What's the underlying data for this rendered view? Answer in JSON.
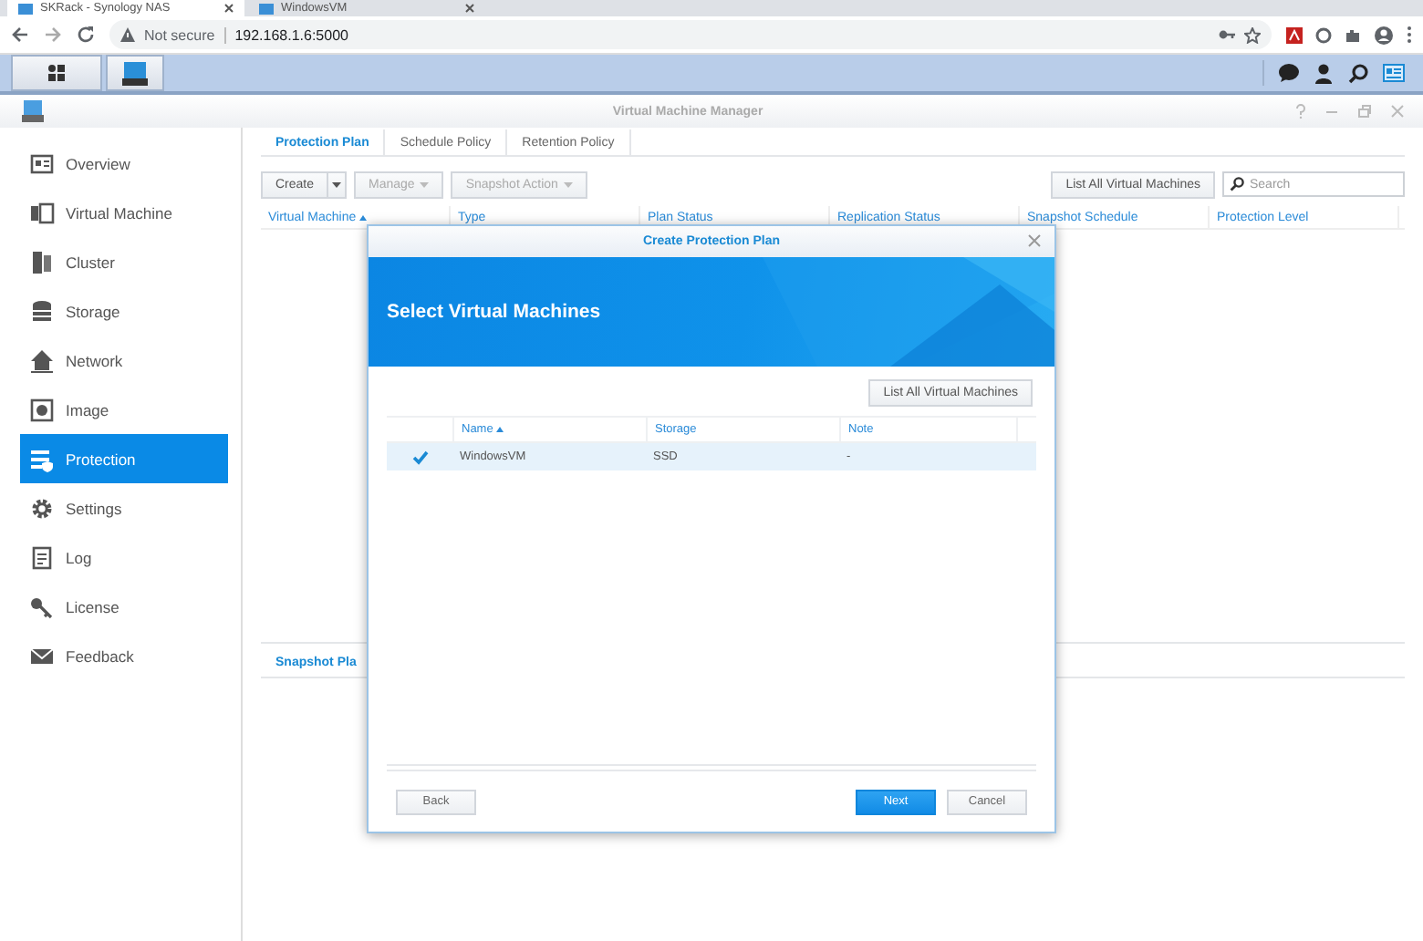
{
  "browser": {
    "tabs": [
      {
        "title": "SKRack - Synology NAS",
        "selected": true
      },
      {
        "title": "WindowsVM",
        "selected": false
      }
    ],
    "security": "Not secure",
    "url": "192.168.1.6:5000"
  },
  "window": {
    "title": "Virtual Machine Manager"
  },
  "sidebar": {
    "items": [
      {
        "label": "Overview",
        "selected": false
      },
      {
        "label": "Virtual Machine",
        "selected": false
      },
      {
        "label": "Cluster",
        "selected": false
      },
      {
        "label": "Storage",
        "selected": false
      },
      {
        "label": "Network",
        "selected": false
      },
      {
        "label": "Image",
        "selected": false
      },
      {
        "label": "Protection",
        "selected": true
      },
      {
        "label": "Settings",
        "selected": false
      },
      {
        "label": "Log",
        "selected": false
      },
      {
        "label": "License",
        "selected": false
      },
      {
        "label": "Feedback",
        "selected": false
      }
    ]
  },
  "tabs": [
    {
      "label": "Protection Plan",
      "selected": true
    },
    {
      "label": "Schedule Policy",
      "selected": false
    },
    {
      "label": "Retention Policy",
      "selected": false
    }
  ],
  "toolbar": {
    "buttons": [
      {
        "label": "Create",
        "kind": "split",
        "disabled": false
      },
      {
        "label": "Manage",
        "kind": "menu",
        "disabled": true
      },
      {
        "label": "Snapshot Action",
        "kind": "menu",
        "disabled": true
      }
    ],
    "list_all": "List All Virtual Machines",
    "search_placeholder": "Search"
  },
  "table": {
    "columns": [
      {
        "label": "Virtual Machine",
        "sorted": true
      },
      {
        "label": "Type",
        "sorted": false
      },
      {
        "label": "Plan Status",
        "sorted": false
      },
      {
        "label": "Replication Status",
        "sorted": false
      },
      {
        "label": "Snapshot Schedule",
        "sorted": false
      },
      {
        "label": "Protection Level",
        "sorted": false
      }
    ]
  },
  "bottom_tabs": [
    {
      "label": "Snapshot Pla",
      "selected": true
    }
  ],
  "dialog": {
    "title": "Create Protection Plan",
    "heading": "Select Virtual Machines",
    "list_all": "List All Virtual Machines",
    "columns": [
      {
        "label": "Name",
        "sorted": true
      },
      {
        "label": "Storage",
        "sorted": false
      },
      {
        "label": "Note",
        "sorted": false
      }
    ],
    "rows": [
      {
        "name": "WindowsVM",
        "storage": "SSD",
        "note": "-",
        "checked": true,
        "selected": true
      }
    ],
    "buttons": [
      {
        "label": "Back",
        "kind": "default"
      },
      {
        "label": "Next",
        "kind": "primary"
      },
      {
        "label": "Cancel",
        "kind": "default"
      }
    ]
  }
}
